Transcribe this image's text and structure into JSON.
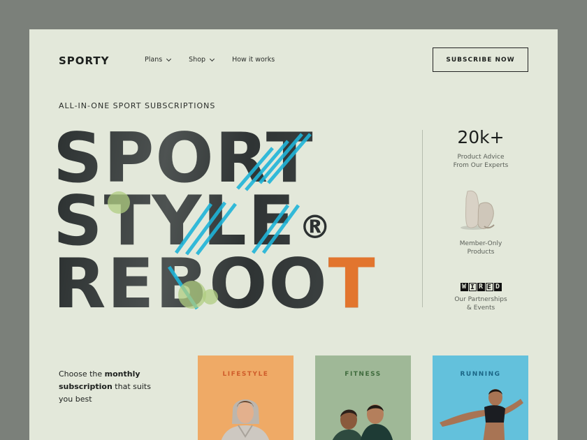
{
  "header": {
    "logo": "SPORTY",
    "nav": [
      {
        "label": "Plans",
        "has_dropdown": true
      },
      {
        "label": "Shop",
        "has_dropdown": true
      },
      {
        "label": "How it works",
        "has_dropdown": false
      }
    ],
    "subscribe_label": "SUBSCRIBE NOW"
  },
  "hero": {
    "eyebrow": "ALL-IN-ONE SPORT SUBSCRIPTIONS",
    "line1": "SPORT",
    "line2": "STYLE",
    "line2_mark": "®",
    "line3_a": "REBOO",
    "line3_b": "T"
  },
  "stats": [
    {
      "value": "20k+",
      "label_1": "Product Advice",
      "label_2": "From Our Experts"
    },
    {
      "icon": "sneakers-icon",
      "label_1": "Member-Only",
      "label_2": "Products"
    },
    {
      "logo_text": "WIRED",
      "label_1": "Our Partnerships",
      "label_2": "& Events"
    }
  ],
  "choose": {
    "pre": "Choose the ",
    "bold1": "monthly",
    "bold2": "subscription",
    "post": " that suits",
    "line3": "you best"
  },
  "cards": [
    {
      "title": "LIFESTYLE",
      "bg": "#efaa66",
      "title_color": "#cf5d2b"
    },
    {
      "title": "FITNESS",
      "bg": "#9fb897",
      "title_color": "#3f6b3d"
    },
    {
      "title": "RUNNING",
      "bg": "#63c1dc",
      "title_color": "#1b6686"
    }
  ],
  "colors": {
    "page_bg": "#e3e8da",
    "outer_bg": "#7b807a",
    "accent_orange": "#e2752e",
    "accent_blue": "#1fb4d8",
    "accent_green": "#b0ce82"
  }
}
